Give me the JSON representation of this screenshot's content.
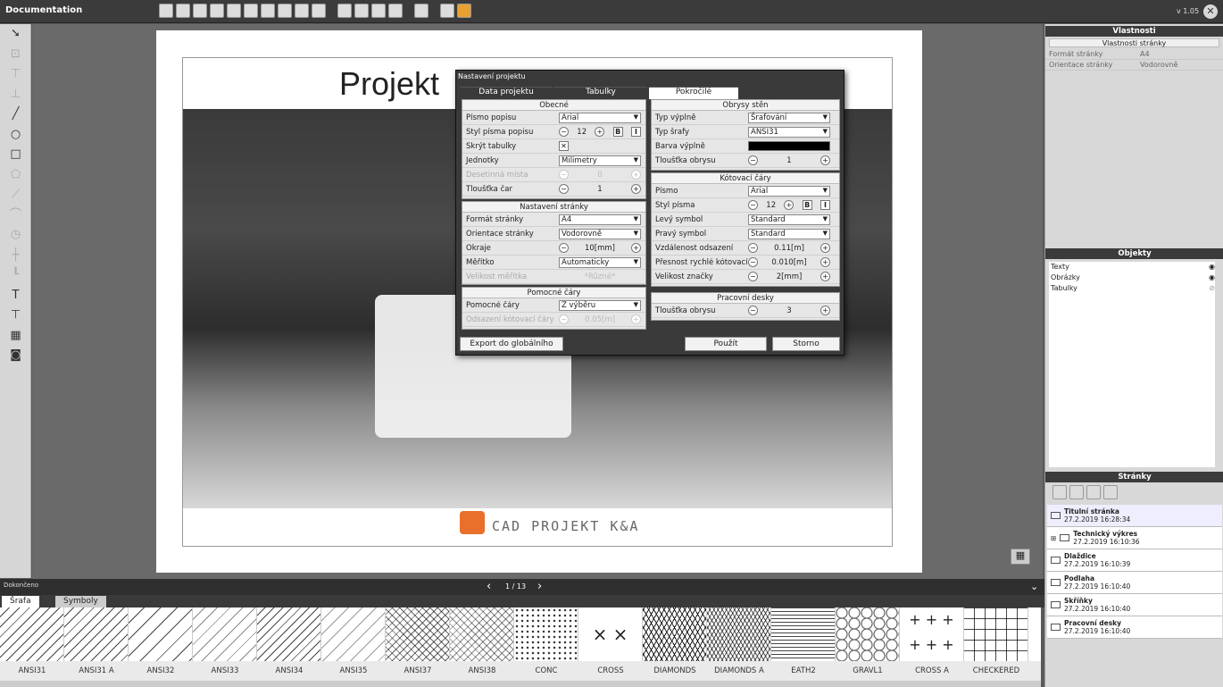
{
  "app": {
    "title": "Documentation",
    "version": "v 1.05"
  },
  "document": {
    "title": "Projekt",
    "logo": "CAD PROJEKT K&A",
    "status": "Dokončeno",
    "pager": "1 / 13"
  },
  "dialog": {
    "title": "Nastavení projektu",
    "tabs": [
      "Data projektu",
      "Tabulky",
      "Pokročilé"
    ],
    "obecne": {
      "title": "Obecné",
      "rows": [
        {
          "label": "Písmo popisu",
          "value": "Arial"
        },
        {
          "label": "Styl písma popisu",
          "value": "12"
        },
        {
          "label": "Skrýt tabulky",
          "value": ""
        },
        {
          "label": "Jednotky",
          "value": "Milimetry"
        },
        {
          "label": "Desetinná místa",
          "value": "0"
        },
        {
          "label": "Tloušťka čar",
          "value": "1"
        }
      ]
    },
    "nastaveni": {
      "title": "Nastavení stránky",
      "rows": [
        {
          "label": "Formát stránky",
          "value": "A4"
        },
        {
          "label": "Orientace stránky",
          "value": "Vodorovně"
        },
        {
          "label": "Okraje",
          "value": "10[mm]"
        },
        {
          "label": "Měřítko",
          "value": "Automaticky"
        },
        {
          "label": "Velikost měřítka",
          "value": "*Různé*"
        }
      ]
    },
    "pomocne": {
      "title": "Pomocné čáry",
      "rows": [
        {
          "label": "Pomocné čáry",
          "value": "Z výběru"
        },
        {
          "label": "Odsazení kótovací čáry",
          "value": "0.05[m]"
        }
      ]
    },
    "obrysy": {
      "title": "Obrysy stěn",
      "rows": [
        {
          "label": "Typ výplně",
          "value": "Šrafování"
        },
        {
          "label": "Typ šrafy",
          "value": "ANSI31"
        },
        {
          "label": "Barva výplně",
          "value": ""
        },
        {
          "label": "Tloušťka obrysu",
          "value": "1"
        }
      ]
    },
    "kotovaci": {
      "title": "Kótovací čáry",
      "rows": [
        {
          "label": "Písmo",
          "value": "Arial"
        },
        {
          "label": "Styl písma",
          "value": "12"
        },
        {
          "label": "Levý symbol",
          "value": "Standard"
        },
        {
          "label": "Pravý symbol",
          "value": "Standard"
        },
        {
          "label": "Vzdálenost odsazení",
          "value": "0.11[m]"
        },
        {
          "label": "Přesnost rychlé kótovací",
          "value": "0.010[m]"
        },
        {
          "label": "Velikost značky",
          "value": "2[mm]"
        }
      ]
    },
    "desky": {
      "title": "Pracovní desky",
      "rows": [
        {
          "label": "Tloušťka obrysu",
          "value": "3"
        }
      ]
    },
    "buttons": {
      "export": "Export do globálního",
      "apply": "Použít",
      "cancel": "Storno"
    },
    "bold": "B",
    "italic": "I"
  },
  "right": {
    "props_header": "Vlastnosti",
    "props_sub": "Vlastnosti stránky",
    "props": [
      {
        "k": "Formát stránky",
        "v": "A4"
      },
      {
        "k": "Orientace stránky",
        "v": "Vodorovně"
      }
    ],
    "objects_header": "Objekty",
    "objects": [
      "Texty",
      "Obrázky",
      "Tabulky"
    ],
    "pages_header": "Stránky",
    "pages": [
      {
        "name": "Titulní stránka",
        "date": "27.2.2019 16:28:34"
      },
      {
        "name": "Technický výkres",
        "date": "27.2.2019 16:10:36"
      },
      {
        "name": "Dlaždice",
        "date": "27.2.2019 16:10:39"
      },
      {
        "name": "Podlaha",
        "date": "27.2.2019 16:10:40"
      },
      {
        "name": "Skříňky",
        "date": "27.2.2019 16:10:40"
      },
      {
        "name": "Pracovní desky",
        "date": "27.2.2019 16:10:40"
      }
    ]
  },
  "bottom": {
    "tabs": [
      "Šrafa",
      "Symboly"
    ],
    "patterns": [
      "ANSI31",
      "ANSI31 A",
      "ANSI32",
      "ANSI33",
      "ANSI34",
      "ANSI35",
      "ANSI37",
      "ANSI38",
      "CONC",
      "CROSS",
      "DIAMONDS",
      "DIAMONDS A",
      "EATH2",
      "GRAVL1",
      "CROSS A",
      "CHECKERED"
    ]
  }
}
